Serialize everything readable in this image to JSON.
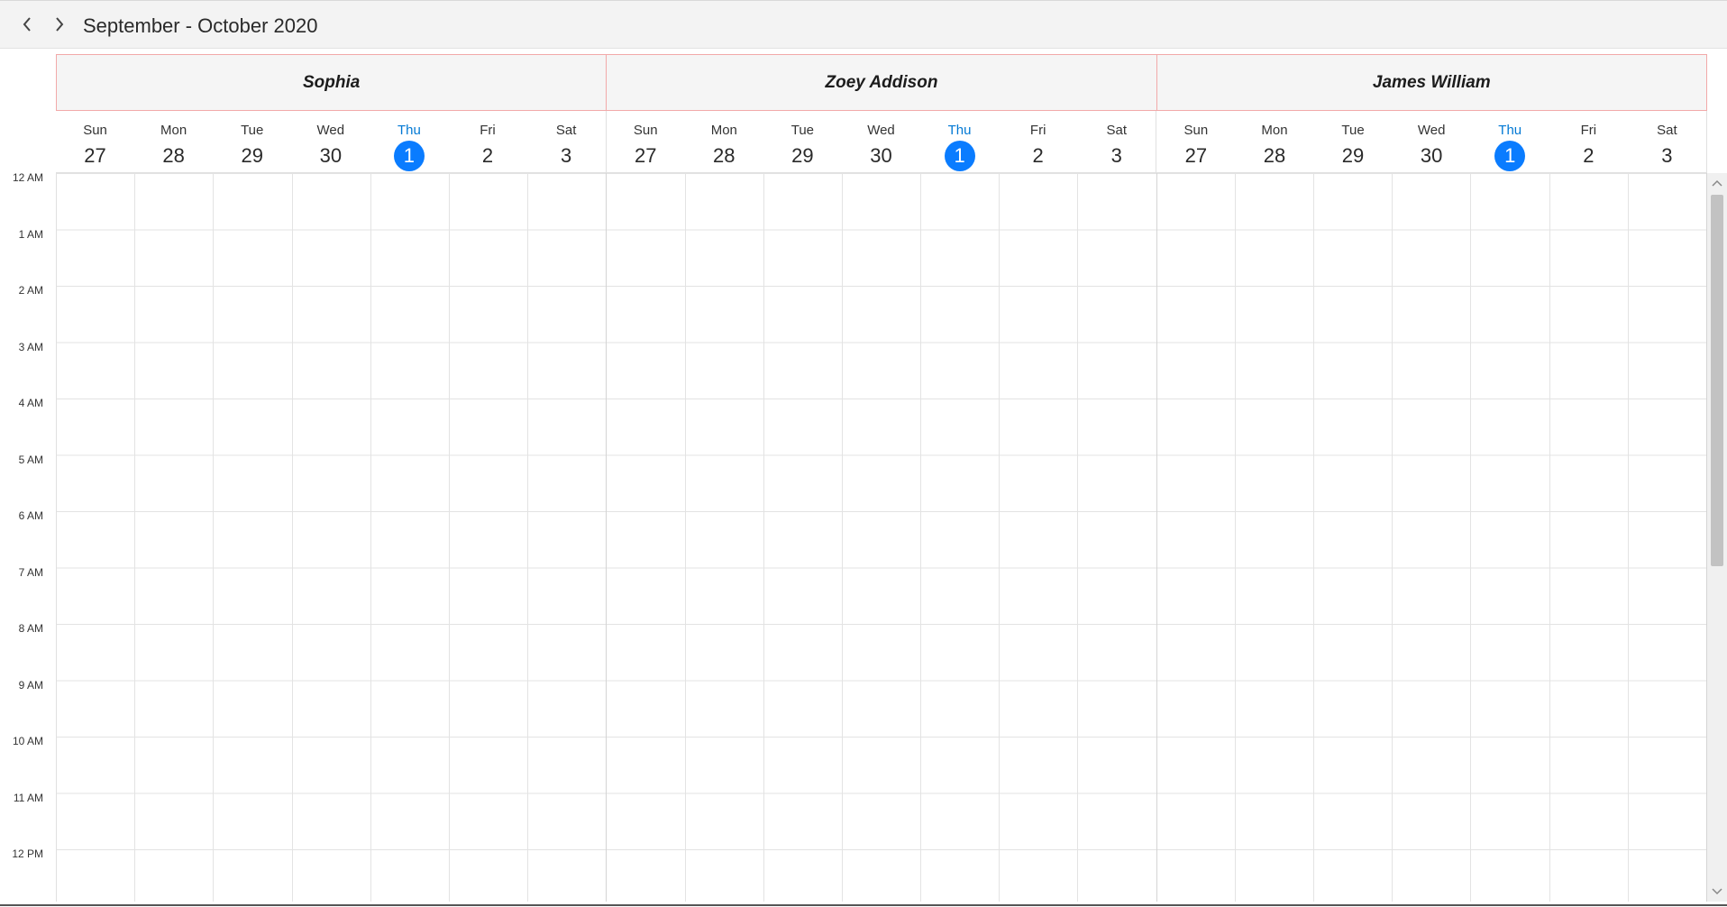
{
  "toolbar": {
    "prev_icon": "chevron-left-icon",
    "next_icon": "chevron-right-icon",
    "title": "September - October 2020"
  },
  "resources": [
    {
      "name": "Sophia",
      "days": [
        {
          "name": "Sun",
          "num": "27"
        },
        {
          "name": "Mon",
          "num": "28"
        },
        {
          "name": "Tue",
          "num": "29"
        },
        {
          "name": "Wed",
          "num": "30"
        },
        {
          "name": "Thu",
          "num": "1"
        },
        {
          "name": "Fri",
          "num": "2"
        },
        {
          "name": "Sat",
          "num": "3"
        }
      ]
    },
    {
      "name": "Zoey Addison",
      "days": [
        {
          "name": "Sun",
          "num": "27"
        },
        {
          "name": "Mon",
          "num": "28"
        },
        {
          "name": "Tue",
          "num": "29"
        },
        {
          "name": "Wed",
          "num": "30"
        },
        {
          "name": "Thu",
          "num": "1"
        },
        {
          "name": "Fri",
          "num": "2"
        },
        {
          "name": "Sat",
          "num": "3"
        }
      ]
    },
    {
      "name": "James William",
      "days": [
        {
          "name": "Sun",
          "num": "27"
        },
        {
          "name": "Mon",
          "num": "28"
        },
        {
          "name": "Tue",
          "num": "29"
        },
        {
          "name": "Wed",
          "num": "30"
        },
        {
          "name": "Thu",
          "num": "1"
        },
        {
          "name": "Fri",
          "num": "2"
        },
        {
          "name": "Sat",
          "num": "3"
        }
      ]
    }
  ],
  "today_day_index": 4,
  "time_slots": [
    "12 AM",
    "1 AM",
    "2 AM",
    "3 AM",
    "4 AM",
    "5 AM",
    "6 AM",
    "7 AM",
    "8 AM",
    "9 AM",
    "10 AM",
    "11 AM",
    "12 PM"
  ],
  "colors": {
    "today_accent": "#0a7cff",
    "resource_border": "#f2a9a9",
    "grid_line": "#e3e3e3",
    "header_bg": "#f5f5f5"
  },
  "scrollbar": {
    "up_icon": "chevron-up-icon",
    "down_icon": "chevron-down-icon"
  }
}
